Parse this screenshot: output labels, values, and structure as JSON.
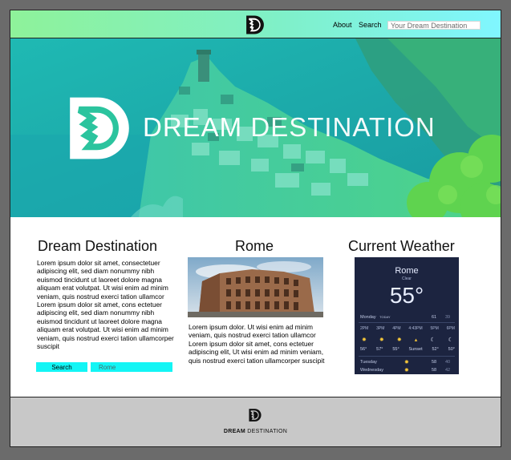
{
  "header": {
    "nav": [
      {
        "label": "About"
      },
      {
        "label": "Search"
      }
    ],
    "search_placeholder": "Your Dream Destination"
  },
  "hero": {
    "title_bold": "DREAM",
    "title_light": "DESTINATION"
  },
  "columns": {
    "left": {
      "title": "Dream Destination",
      "text": "Lorem ipsum dolor sit amet, consectetuer adipiscing elit, sed diam nonummy nibh euismod tincidunt ut laoreet dolore magna aliquam erat volutpat. Ut wisi enim ad minim veniam, quis nostrud exerci tation ullamcor Lorem ipsum dolor sit amet, cons ectetuer adipiscing elit, sed diam nonummy nibh euismod tincidunt ut laoreet dolore magna aliquam erat volutpat. Ut wisi enim ad minim veniam, quis nostrud exerci tation ullamcorper suscipit",
      "search_button": "Search",
      "search_input_placeholder": "Rome"
    },
    "middle": {
      "title": "Rome",
      "text": "Lorem ipsum dolor. Ut wisi enim ad minim veniam, quis nostrud exerci tation ullamcor Lorem ipsum dolor sit amet, cons ectetuer adipiscing elit, Ut wisi enim ad minim veniam, quis nostrud exerci tation ullamcorper suscipit"
    },
    "right": {
      "title": "Current Weather",
      "widget": {
        "city": "Rome",
        "condition": "Clear",
        "temperature": "55°",
        "day": "Monday",
        "day_tag": "TODAY",
        "high": "61",
        "low": "39",
        "hours": [
          "2PM",
          "3PM",
          "4PM",
          "4:43PM",
          "5PM",
          "6PM"
        ],
        "hour_temps": [
          "56°",
          "57°",
          "55°",
          "Sunset",
          "52°",
          "50°"
        ],
        "next_day": "Tuesday",
        "next_high": "58",
        "next_low": "40",
        "third_day": "Wednesday",
        "third_high": "58",
        "third_low": "42"
      }
    }
  },
  "footer": {
    "brand_bold": "DREAM",
    "brand_light": "DESTINATION"
  },
  "colors": {
    "accent": "#13f5f5",
    "header_gradient_start": "#8ef29a",
    "header_gradient_end": "#80f6ff",
    "footer_bg": "#c8c8c8"
  }
}
